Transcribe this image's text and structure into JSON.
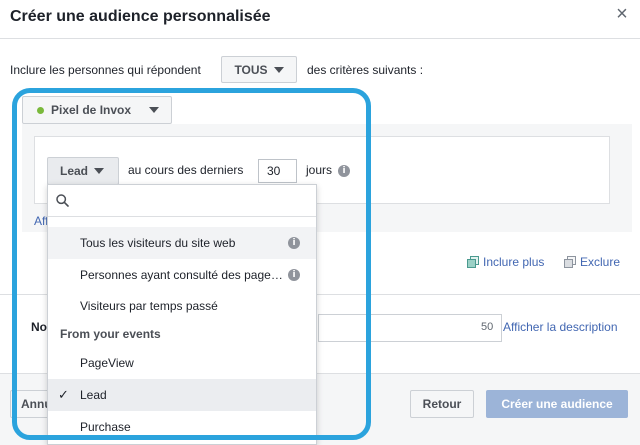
{
  "dialog": {
    "title": "Créer une audience personnalisée",
    "close_glyph": "×"
  },
  "criteria": {
    "include_text": "Inclure les personnes qui répondent",
    "match_value": "TOUS",
    "suffix_text": "des critères suivants :"
  },
  "pixel": {
    "label": "Pixel de Invox",
    "status_color": "#7ab93b"
  },
  "rule": {
    "event_value": "Lead",
    "during_text": "au cours des derniers",
    "days_value": "30",
    "days_unit": "jours"
  },
  "links": {
    "aff_partial": "Aff",
    "include_more": "Inclure plus",
    "exclude": "Exclure",
    "show_description": "Afficher la description"
  },
  "name_section": {
    "label_partial": "No",
    "char_count": "50"
  },
  "footer": {
    "cancel_partial": "Annu",
    "back_label": "Retour",
    "create_label": "Créer une audience"
  },
  "dropdown": {
    "search_placeholder": "",
    "items": [
      {
        "label": "Tous les visiteurs du site web",
        "info": true
      },
      {
        "label": "Personnes ayant consulté des pages spécifiques",
        "info": true
      },
      {
        "label": "Visiteurs par temps passé",
        "info": false
      }
    ],
    "events_header": "From your events",
    "events": [
      {
        "label": "PageView",
        "selected": false
      },
      {
        "label": "Lead",
        "selected": true
      },
      {
        "label": "Purchase",
        "selected": false
      }
    ]
  },
  "colors": {
    "highlight": "#2ba3dd",
    "link": "#4267b2",
    "create_button": "#9cb4d8"
  }
}
